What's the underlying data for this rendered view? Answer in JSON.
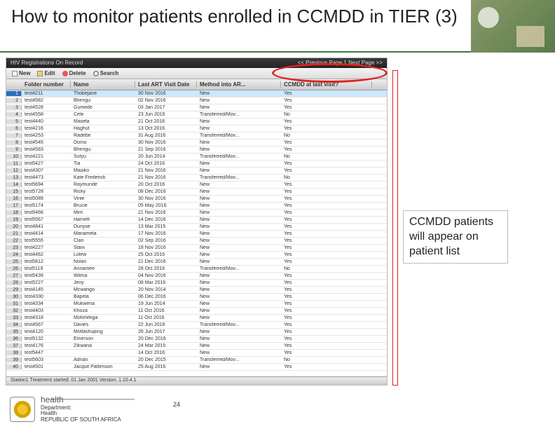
{
  "title": "How to monitor patients enrolled in CCMDD in TIER (3)",
  "app_header": {
    "left": "HIV Registrations On Record",
    "right": "<< Previous Page 1   Next Page >>"
  },
  "toolbar": {
    "new": "New",
    "edit": "Edit",
    "delete": "Delete",
    "search": "Search"
  },
  "columns": [
    "",
    "Folder number",
    "Name",
    "Last ART Visit Date",
    "Method into AR...",
    "CCMDD at last visit?"
  ],
  "rows": [
    {
      "n": 1,
      "folder": "test4211",
      "name": "Thobejane",
      "date": "30 Nov 2016",
      "method": "New",
      "ccmdd": "Yes",
      "sel": true
    },
    {
      "n": 2,
      "folder": "test4582",
      "name": "Bhengu",
      "date": "02 Nov 2016",
      "method": "New",
      "ccmdd": "Yes"
    },
    {
      "n": 3,
      "folder": "test4528",
      "name": "Gumede",
      "date": "03 Jan 2017",
      "method": "New",
      "ccmdd": "Yes"
    },
    {
      "n": 4,
      "folder": "test4558",
      "name": "Cele",
      "date": "23 Jun 2016",
      "method": "Transferred/Mov...",
      "ccmdd": "No"
    },
    {
      "n": 5,
      "folder": "test4440",
      "name": "Masela",
      "date": "21 Oct 2016",
      "method": "New",
      "ccmdd": "Yes"
    },
    {
      "n": 6,
      "folder": "test4216",
      "name": "Haghut",
      "date": "13 Oct 2016",
      "method": "New",
      "ccmdd": "Yes"
    },
    {
      "n": 7,
      "folder": "test4253",
      "name": "Radebe",
      "date": "31 Aug 2016",
      "method": "Transferred/Mov...",
      "ccmdd": "No"
    },
    {
      "n": 8,
      "folder": "test4545",
      "name": "Domo",
      "date": "30 Nov 2016",
      "method": "New",
      "ccmdd": "Yes"
    },
    {
      "n": 9,
      "folder": "test4583",
      "name": "Bhengu",
      "date": "21 Sep 2016",
      "method": "New",
      "ccmdd": "Yes"
    },
    {
      "n": 10,
      "folder": "test4221",
      "name": "Sutyu",
      "date": "20 Jun 2014",
      "method": "Transferred/Mov...",
      "ccmdd": "No"
    },
    {
      "n": 11,
      "folder": "test5427",
      "name": "Tia",
      "date": "24 Oct 2016",
      "method": "New",
      "ccmdd": "Yes"
    },
    {
      "n": 12,
      "folder": "test4307",
      "name": "Masiko",
      "date": "21 Nov 2016",
      "method": "New",
      "ccmdd": "Yes"
    },
    {
      "n": 13,
      "folder": "test4473",
      "name": "Kate Frederick",
      "date": "21 Nov 2016",
      "method": "Transferred/Mov...",
      "ccmdd": "No"
    },
    {
      "n": 14,
      "folder": "test5694",
      "name": "Raymunde",
      "date": "20 Oct 2016",
      "method": "New",
      "ccmdd": "Yes"
    },
    {
      "n": 15,
      "folder": "test5728",
      "name": "Ricky",
      "date": "08 Dec 2016",
      "method": "New",
      "ccmdd": "Yes"
    },
    {
      "n": 16,
      "folder": "test5089",
      "name": "Vinie",
      "date": "30 Nov 2016",
      "method": "New",
      "ccmdd": "Yes"
    },
    {
      "n": 17,
      "folder": "test5174",
      "name": "Brucie",
      "date": "05 May 2016",
      "method": "New",
      "ccmdd": "Yes"
    },
    {
      "n": 18,
      "folder": "test5466",
      "name": "Mim",
      "date": "21 Nov 2016",
      "method": "New",
      "ccmdd": "Yes"
    },
    {
      "n": 19,
      "folder": "test5567",
      "name": "Harriett",
      "date": "14 Dec 2016",
      "method": "New",
      "ccmdd": "Yes"
    },
    {
      "n": 20,
      "folder": "test4841",
      "name": "Dunyse",
      "date": "13 Mar 2015",
      "method": "New",
      "ccmdd": "Yes"
    },
    {
      "n": 21,
      "folder": "test4414",
      "name": "Manamela",
      "date": "17 Nov 2016",
      "method": "New",
      "ccmdd": "Yes"
    },
    {
      "n": 22,
      "folder": "test5555",
      "name": "Clari",
      "date": "02 Sep 2016",
      "method": "New",
      "ccmdd": "Yes"
    },
    {
      "n": 23,
      "folder": "test4227",
      "name": "Stani",
      "date": "18 Nov 2016",
      "method": "New",
      "ccmdd": "Yes"
    },
    {
      "n": 24,
      "folder": "test4462",
      "name": "Lolew",
      "date": "25 Oct 2016",
      "method": "New",
      "ccmdd": "Yes"
    },
    {
      "n": 25,
      "folder": "test5812",
      "name": "Nolan",
      "date": "21 Dec 2016",
      "method": "New",
      "ccmdd": "Yes"
    },
    {
      "n": 26,
      "folder": "test5119",
      "name": "Annamee",
      "date": "28 Oct 2016",
      "method": "Transferred/Mov...",
      "ccmdd": "No"
    },
    {
      "n": 27,
      "folder": "test5439",
      "name": "Wilma",
      "date": "04 Nov 2016",
      "method": "New",
      "ccmdd": "Yes"
    },
    {
      "n": 28,
      "folder": "test5227",
      "name": "Jeny",
      "date": "08 Mar 2016",
      "method": "New",
      "ccmdd": "Yes"
    },
    {
      "n": 29,
      "folder": "test4145",
      "name": "Mcwango",
      "date": "20 Nov 2014",
      "method": "New",
      "ccmdd": "Yes"
    },
    {
      "n": 30,
      "folder": "test4330",
      "name": "Bapela",
      "date": "06 Dec 2016",
      "method": "New",
      "ccmdd": "Yes"
    },
    {
      "n": 31,
      "folder": "test4334",
      "name": "Mukwena",
      "date": "19 Jun 2014",
      "method": "New",
      "ccmdd": "Yes"
    },
    {
      "n": 32,
      "folder": "test4403",
      "name": "Khoza",
      "date": "11 Oct 2016",
      "method": "New",
      "ccmdd": "Yes"
    },
    {
      "n": 33,
      "folder": "test4318",
      "name": "Motshekga",
      "date": "11 Oct 2016",
      "method": "New",
      "ccmdd": "Yes"
    },
    {
      "n": 34,
      "folder": "test4567",
      "name": "Davies",
      "date": "22 Jun 2016",
      "method": "Transferred/Mov...",
      "ccmdd": "Yes"
    },
    {
      "n": 35,
      "folder": "test4120",
      "name": "Motlashuping",
      "date": "26 Jun 2017",
      "method": "New",
      "ccmdd": "Yes"
    },
    {
      "n": 36,
      "folder": "test5132",
      "name": "Emerson",
      "date": "20 Dec 2016",
      "method": "New",
      "ccmdd": "Yes"
    },
    {
      "n": 37,
      "folder": "test4176",
      "name": "Zikwana",
      "date": "24 Mar 2015",
      "method": "New",
      "ccmdd": "Yes"
    },
    {
      "n": 38,
      "folder": "test5447",
      "name": "",
      "date": "14 Oct 2016",
      "method": "New",
      "ccmdd": "Yes"
    },
    {
      "n": 39,
      "folder": "test5603",
      "name": "Adrian",
      "date": "20 Dec 2015",
      "method": "Transferred/Mov...",
      "ccmdd": "No"
    },
    {
      "n": 40,
      "folder": "test4501",
      "name": "Jacquit Pattenson",
      "date": "25 Aug 2016",
      "method": "New",
      "ccmdd": "Yes"
    }
  ],
  "status_bar": "Station1  Treatment started:  01 Jan 2001  Version: 1.10.4.1",
  "annotation": "CCMDD patients will appear on patient list",
  "footer": {
    "brand": "health",
    "dept1": "Department:",
    "dept2": "Health",
    "dept3": "REPUBLIC OF SOUTH AFRICA"
  },
  "page_number": "24"
}
